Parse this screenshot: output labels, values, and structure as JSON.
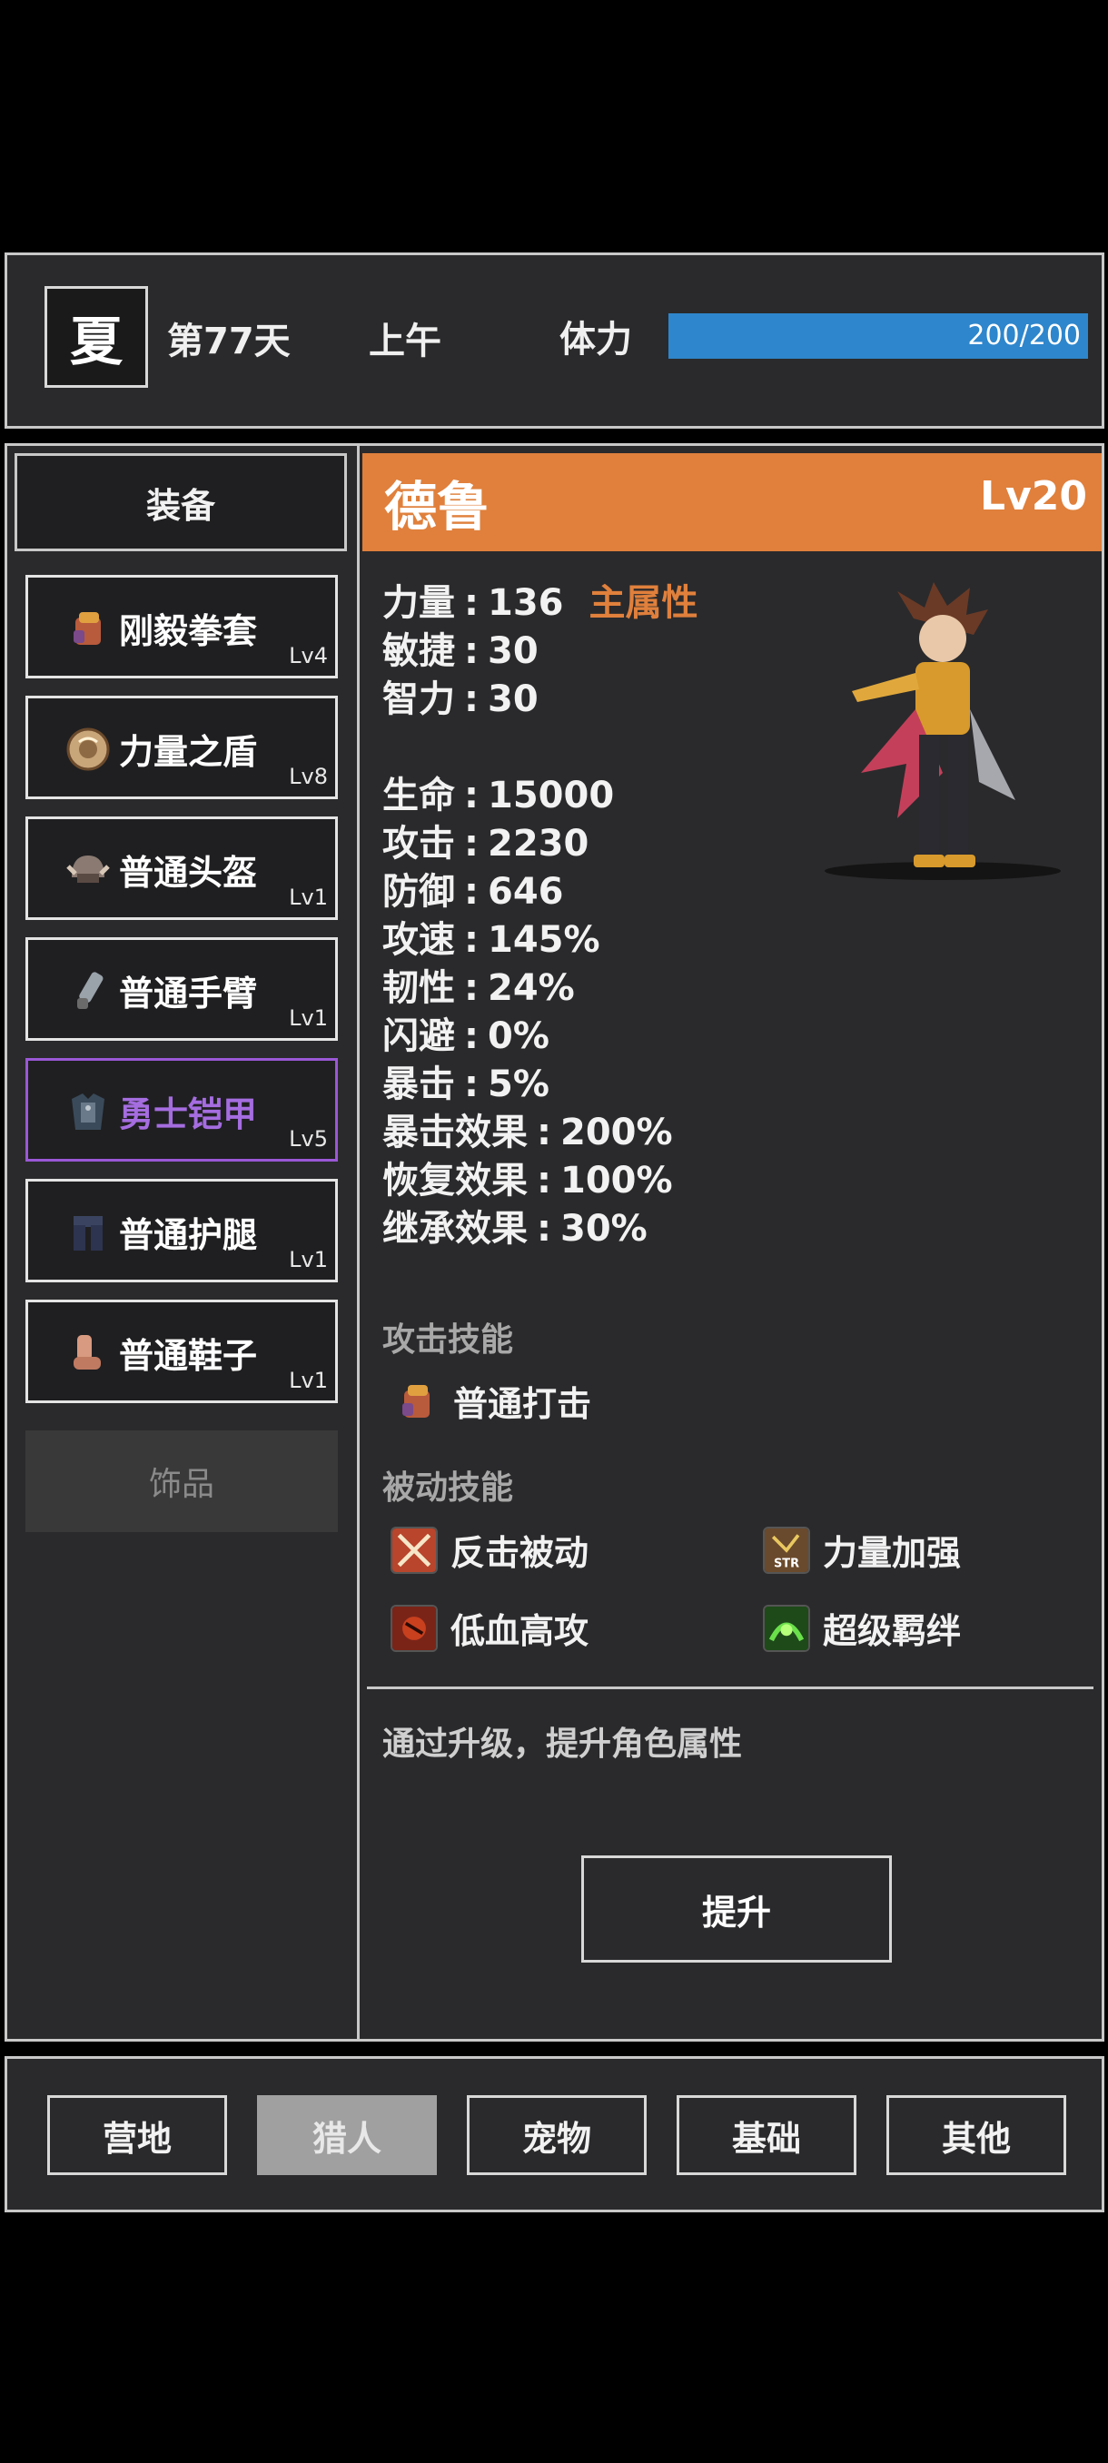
{
  "status": {
    "season": "夏",
    "day": "第77天",
    "time": "上午",
    "stamina_label": "体力",
    "stamina_text": "200/200",
    "stamina_fraction": 1.0
  },
  "equipment": {
    "header": "装备",
    "slots": [
      {
        "name": "刚毅拳套",
        "level": "Lv4",
        "rarity": "purple",
        "icon": "gauntlet-icon"
      },
      {
        "name": "力量之盾",
        "level": "Lv8",
        "rarity": "purple",
        "icon": "shield-icon"
      },
      {
        "name": "普通头盔",
        "level": "Lv1",
        "rarity": "common",
        "icon": "helmet-icon"
      },
      {
        "name": "普通手臂",
        "level": "Lv1",
        "rarity": "common",
        "icon": "arm-guard-icon"
      },
      {
        "name": "勇士铠甲",
        "level": "Lv5",
        "rarity": "purple",
        "icon": "armor-icon"
      },
      {
        "name": "普通护腿",
        "level": "Lv1",
        "rarity": "common",
        "icon": "leg-guard-icon"
      },
      {
        "name": "普通鞋子",
        "level": "Lv1",
        "rarity": "common",
        "icon": "boots-icon"
      }
    ],
    "accessory": "饰品"
  },
  "hero": {
    "name": "德鲁",
    "level": "Lv20",
    "primary_tag": "主属性",
    "base_stats": [
      {
        "label": "力量",
        "value": "136"
      },
      {
        "label": "敏捷",
        "value": "30"
      },
      {
        "label": "智力",
        "value": "30"
      }
    ],
    "combat_stats": [
      {
        "label": "生命",
        "value": "15000"
      },
      {
        "label": "攻击",
        "value": "2230"
      },
      {
        "label": "防御",
        "value": "646"
      },
      {
        "label": "攻速",
        "value": "145%"
      },
      {
        "label": "韧性",
        "value": "24%"
      },
      {
        "label": "闪避",
        "value": "0%"
      },
      {
        "label": "暴击",
        "value": "5%"
      },
      {
        "label": "暴击效果",
        "value": "200%"
      },
      {
        "label": "恢复效果",
        "value": "100%"
      },
      {
        "label": "继承效果",
        "value": "30%"
      }
    ]
  },
  "skills": {
    "attack_title": "攻击技能",
    "attack": [
      {
        "name": "普通打击",
        "icon": "gauntlet-icon"
      }
    ],
    "passive_title": "被动技能",
    "passive": [
      {
        "name": "反击被动",
        "icon": "crossed-swords-icon"
      },
      {
        "name": "力量加强",
        "icon": "str-icon"
      },
      {
        "name": "低血高攻",
        "icon": "rage-icon"
      },
      {
        "name": "超级羁绊",
        "icon": "bond-icon"
      }
    ]
  },
  "upgrade": {
    "hint": "通过升级，提升角色属性",
    "button": "提升"
  },
  "nav": {
    "tabs": [
      "营地",
      "猎人",
      "宠物",
      "基础",
      "其他"
    ],
    "active_index": 1
  },
  "colors": {
    "accent_orange": "#e0803c",
    "rarity_purple": "#9a58d6",
    "stamina_blue": "#2e86cc"
  }
}
